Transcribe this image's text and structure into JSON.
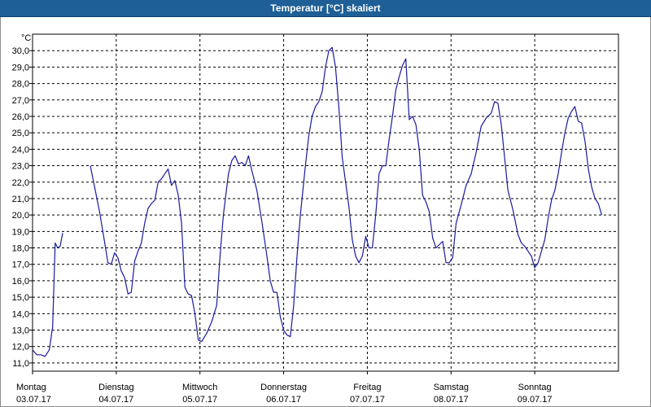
{
  "window": {
    "title": "Temperatur [°C] skaliert"
  },
  "chart_data": {
    "type": "line",
    "title": "Temperatur [°C] skaliert",
    "ylabel": "°C",
    "xlabel": "",
    "ylim": [
      10.5,
      31.0
    ],
    "yticks": [
      "11,0",
      "12,0",
      "13,0",
      "14,0",
      "15,0",
      "16,0",
      "17,0",
      "18,0",
      "19,0",
      "20,0",
      "21,0",
      "22,0",
      "23,0",
      "24,0",
      "25,0",
      "26,0",
      "27,0",
      "28,0",
      "29,0",
      "30,0"
    ],
    "xlim": [
      0,
      7
    ],
    "grid": true,
    "line_color": "#1a1aa0",
    "days": [
      {
        "name": "Montag",
        "date": "03.07.17"
      },
      {
        "name": "Dienstag",
        "date": "04.07.17"
      },
      {
        "name": "Mittwoch",
        "date": "05.07.17"
      },
      {
        "name": "Donnerstag",
        "date": "06.07.17"
      },
      {
        "name": "Freitag",
        "date": "07.07.17"
      },
      {
        "name": "Samstag",
        "date": "08.07.17"
      },
      {
        "name": "Sonntag",
        "date": "09.07.17"
      }
    ],
    "series": [
      {
        "segments": [
          [
            [
              0.0,
              11.8
            ],
            [
              0.05,
              11.5
            ],
            [
              0.1,
              11.5
            ],
            [
              0.15,
              11.4
            ],
            [
              0.2,
              11.8
            ],
            [
              0.24,
              13.2
            ],
            [
              0.27,
              18.3
            ],
            [
              0.3,
              18.0
            ],
            [
              0.33,
              18.1
            ],
            [
              0.36,
              18.9
            ]
          ],
          [
            [
              0.69,
              23.0
            ],
            [
              0.75,
              21.5
            ],
            [
              0.8,
              20.2
            ],
            [
              0.85,
              18.7
            ],
            [
              0.9,
              17.1
            ],
            [
              0.94,
              17.0
            ],
            [
              0.98,
              17.7
            ],
            [
              1.02,
              17.4
            ],
            [
              1.06,
              16.6
            ],
            [
              1.1,
              16.2
            ],
            [
              1.14,
              15.2
            ],
            [
              1.18,
              15.3
            ],
            [
              1.22,
              17.2
            ],
            [
              1.26,
              17.8
            ],
            [
              1.3,
              18.3
            ],
            [
              1.34,
              19.5
            ],
            [
              1.38,
              20.4
            ],
            [
              1.42,
              20.7
            ],
            [
              1.46,
              20.9
            ],
            [
              1.5,
              22.0
            ],
            [
              1.54,
              22.2
            ],
            [
              1.58,
              22.5
            ],
            [
              1.62,
              22.8
            ],
            [
              1.66,
              21.8
            ],
            [
              1.7,
              22.1
            ],
            [
              1.74,
              21.2
            ],
            [
              1.78,
              19.5
            ],
            [
              1.82,
              15.6
            ],
            [
              1.86,
              15.2
            ],
            [
              1.9,
              15.1
            ],
            [
              1.94,
              14.0
            ],
            [
              1.98,
              12.4
            ],
            [
              2.02,
              12.3
            ],
            [
              2.08,
              12.8
            ],
            [
              2.14,
              13.5
            ],
            [
              2.2,
              14.5
            ],
            [
              2.24,
              17.5
            ],
            [
              2.28,
              20.0
            ],
            [
              2.34,
              22.5
            ],
            [
              2.38,
              23.3
            ],
            [
              2.42,
              23.6
            ],
            [
              2.46,
              23.1
            ],
            [
              2.5,
              23.2
            ],
            [
              2.54,
              23.0
            ],
            [
              2.58,
              23.6
            ],
            [
              2.62,
              22.7
            ],
            [
              2.68,
              21.5
            ],
            [
              2.74,
              19.6
            ],
            [
              2.8,
              17.5
            ],
            [
              2.84,
              16.0
            ],
            [
              2.88,
              15.3
            ],
            [
              2.92,
              15.3
            ],
            [
              2.96,
              13.8
            ],
            [
              3.0,
              13.0
            ],
            [
              3.04,
              12.7
            ],
            [
              3.08,
              12.6
            ],
            [
              3.12,
              14.5
            ],
            [
              3.16,
              17.5
            ],
            [
              3.2,
              20.0
            ],
            [
              3.26,
              23.0
            ],
            [
              3.3,
              24.8
            ],
            [
              3.34,
              26.0
            ],
            [
              3.38,
              26.6
            ],
            [
              3.42,
              26.9
            ],
            [
              3.46,
              27.5
            ],
            [
              3.5,
              29.0
            ],
            [
              3.54,
              30.0
            ],
            [
              3.58,
              30.2
            ],
            [
              3.62,
              29.0
            ],
            [
              3.66,
              26.5
            ],
            [
              3.7,
              23.5
            ],
            [
              3.74,
              22.0
            ],
            [
              3.78,
              20.5
            ],
            [
              3.82,
              18.5
            ],
            [
              3.86,
              17.5
            ],
            [
              3.9,
              17.1
            ],
            [
              3.94,
              17.5
            ],
            [
              3.98,
              18.7
            ],
            [
              4.02,
              18.0
            ],
            [
              4.06,
              18.0
            ],
            [
              4.1,
              20.0
            ],
            [
              4.14,
              22.5
            ],
            [
              4.18,
              23.0
            ],
            [
              4.22,
              23.0
            ],
            [
              4.26,
              24.6
            ],
            [
              4.3,
              26.0
            ],
            [
              4.34,
              27.6
            ],
            [
              4.38,
              28.4
            ],
            [
              4.42,
              29.1
            ],
            [
              4.46,
              29.5
            ],
            [
              4.5,
              25.8
            ],
            [
              4.54,
              26.0
            ],
            [
              4.58,
              25.5
            ],
            [
              4.62,
              24.0
            ],
            [
              4.66,
              21.2
            ],
            [
              4.7,
              20.8
            ],
            [
              4.74,
              20.2
            ],
            [
              4.78,
              18.6
            ],
            [
              4.82,
              18.0
            ],
            [
              4.86,
              18.2
            ],
            [
              4.9,
              18.4
            ],
            [
              4.94,
              17.1
            ],
            [
              4.98,
              17.1
            ],
            [
              5.02,
              17.4
            ],
            [
              5.06,
              19.5
            ],
            [
              5.12,
              20.6
            ],
            [
              5.18,
              21.8
            ],
            [
              5.24,
              22.5
            ],
            [
              5.3,
              23.8
            ],
            [
              5.36,
              25.4
            ],
            [
              5.42,
              25.9
            ],
            [
              5.48,
              26.2
            ],
            [
              5.52,
              26.9
            ],
            [
              5.56,
              26.8
            ],
            [
              5.6,
              25.5
            ],
            [
              5.64,
              23.5
            ],
            [
              5.68,
              21.5
            ],
            [
              5.74,
              20.3
            ],
            [
              5.8,
              18.8
            ],
            [
              5.84,
              18.3
            ],
            [
              5.88,
              18.1
            ],
            [
              5.92,
              17.8
            ],
            [
              5.96,
              17.5
            ],
            [
              6.0,
              16.8
            ],
            [
              6.04,
              17.1
            ],
            [
              6.08,
              17.8
            ],
            [
              6.12,
              18.5
            ],
            [
              6.16,
              19.8
            ],
            [
              6.2,
              20.9
            ],
            [
              6.24,
              21.5
            ],
            [
              6.28,
              22.5
            ],
            [
              6.32,
              23.8
            ],
            [
              6.36,
              25.0
            ],
            [
              6.4,
              25.9
            ],
            [
              6.44,
              26.3
            ],
            [
              6.48,
              26.6
            ],
            [
              6.52,
              25.7
            ],
            [
              6.56,
              25.6
            ],
            [
              6.6,
              24.5
            ],
            [
              6.64,
              22.8
            ],
            [
              6.68,
              21.7
            ],
            [
              6.72,
              21.0
            ],
            [
              6.76,
              20.7
            ],
            [
              6.8,
              20.0
            ]
          ]
        ]
      }
    ]
  }
}
